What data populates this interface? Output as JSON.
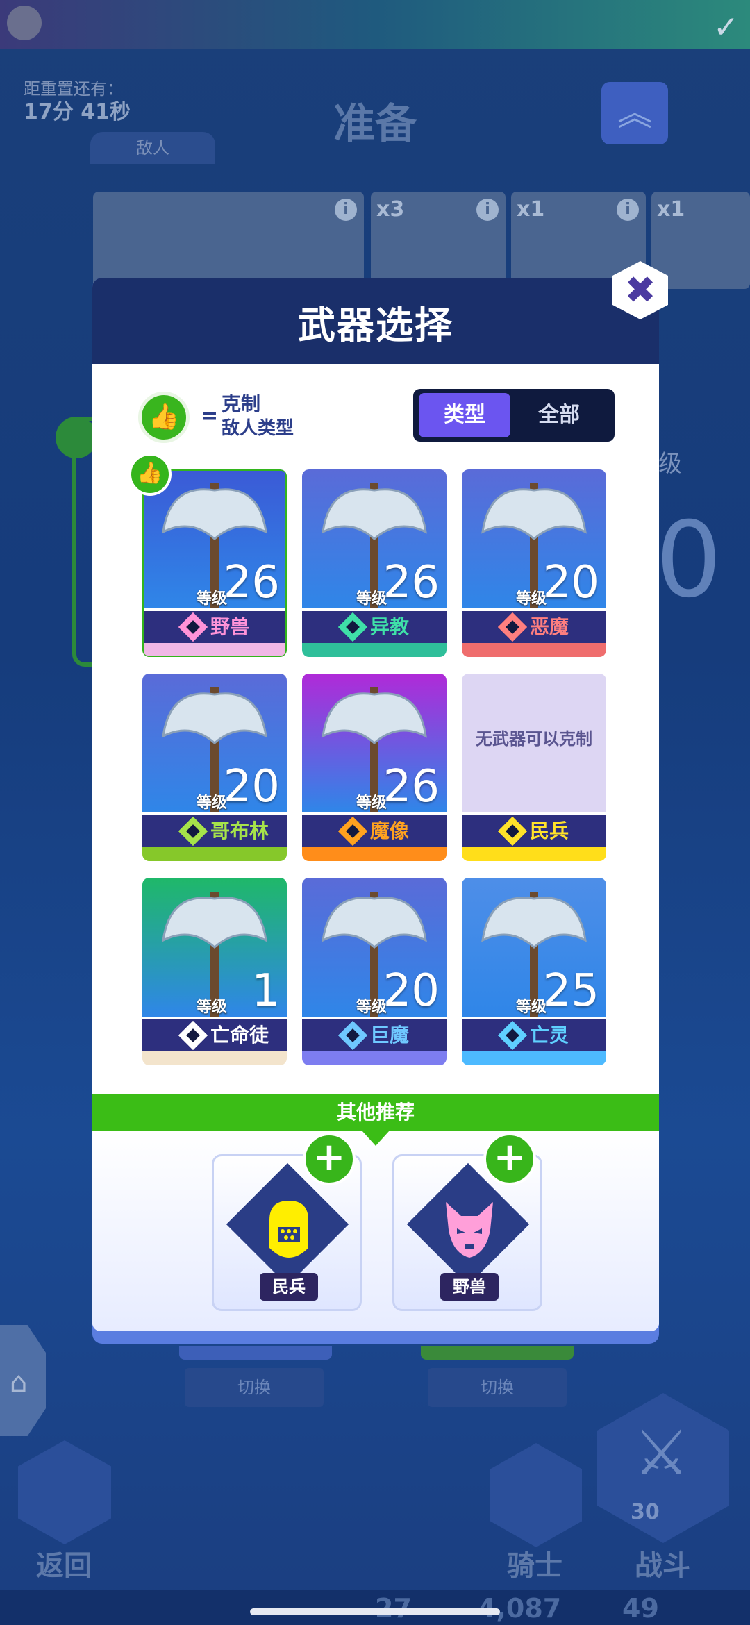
{
  "background": {
    "timer_label": "距重置还有：",
    "timer_value": "17分 41秒",
    "screen_title": "准备",
    "enemy_tab": "敌人",
    "enemy_cards": [
      {
        "count": "",
        "info": "i"
      },
      {
        "count": "x3",
        "info": "i"
      },
      {
        "count": "x1",
        "info": "i"
      },
      {
        "count": "x1",
        "info": ""
      }
    ],
    "right_level_word": "级",
    "right_big_digit": "0",
    "switch_left": "切换",
    "switch_right": "切换",
    "back_label": "返回",
    "knight_label": "骑士",
    "battle_label": "战斗",
    "battle_cost": "30",
    "currency_1": "27",
    "currency_2": "4,087",
    "currency_3": "49"
  },
  "modal": {
    "title": "武器选择",
    "close_icon": "close-icon",
    "legend": {
      "equals": "=",
      "line1": "克制",
      "line2": "敌人类型"
    },
    "toggle": {
      "type_label": "类型",
      "all_label": "全部"
    },
    "level_word": "等级",
    "weapons": [
      {
        "level": "26",
        "type": "野兽",
        "bg": "#3b5ad6",
        "tag_color": "#ff93d8",
        "foot": "#f0b8e6",
        "selected": true
      },
      {
        "level": "26",
        "type": "异教",
        "bg": "#5a6bd8",
        "tag_color": "#3fe0a8",
        "foot": "#2fbf9a"
      },
      {
        "level": "20",
        "type": "恶魔",
        "bg": "#5a6bd8",
        "tag_color": "#ff7f7f",
        "foot": "#ef6d6d"
      },
      {
        "level": "20",
        "type": "哥布林",
        "bg": "#5a6bd8",
        "tag_color": "#a6e34a",
        "foot": "#86c82a"
      },
      {
        "level": "26",
        "type": "魔像",
        "bg": "#b02ad8",
        "tag_color": "#ffa21f",
        "foot": "#ff8d1a"
      },
      {
        "level": "",
        "type": "民兵",
        "no_weapon_text": "无武器可以克制",
        "bg": "#ddd6f3",
        "tag_color": "#ffe22a",
        "foot": "#ffde1a"
      },
      {
        "level": "1",
        "type": "亡命徒",
        "bg": "#1fb869",
        "tag_color": "#ffffff",
        "foot": "#f3e4cc"
      },
      {
        "level": "20",
        "type": "巨魔",
        "bg": "#5a6bd8",
        "tag_color": "#6fc8ff",
        "foot": "#7d7df0"
      },
      {
        "level": "25",
        "type": "亡灵",
        "bg": "#4e8ee8",
        "tag_color": "#5fd0ff",
        "foot": "#4dbaff"
      }
    ],
    "recommend_title": "其他推荐",
    "recommend": [
      {
        "label": "民兵",
        "color": "#ffee00"
      },
      {
        "label": "野兽",
        "color": "#ff9fd9"
      }
    ]
  }
}
